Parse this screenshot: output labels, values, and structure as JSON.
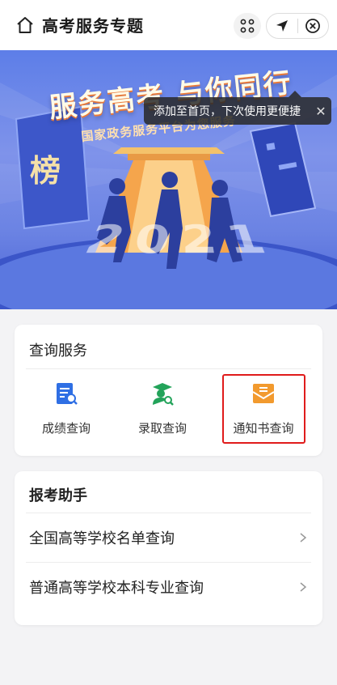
{
  "header": {
    "title": "高考服务专题",
    "home_icon": "home-icon",
    "more_icon": "more-dots-icon",
    "location_icon": "location-arrow-icon",
    "close_icon": "close-circle-icon"
  },
  "tooltip": {
    "text": "添加至首页，下次使用更便捷",
    "close_label": "✕"
  },
  "banner": {
    "slogan": "服务高考 与你同行",
    "sub_slogan": "国家政务服务平台为您服务",
    "board_char": "榜",
    "year": "2021"
  },
  "query_card": {
    "title": "查询服务",
    "items": [
      {
        "label": "成绩查询",
        "icon": "score-query-icon",
        "color": "#2f6fe4"
      },
      {
        "label": "录取查询",
        "icon": "admission-query-icon",
        "color": "#23a35a"
      },
      {
        "label": "通知书查询",
        "icon": "notice-letter-icon",
        "color": "#f29a2e"
      }
    ]
  },
  "assistant_card": {
    "title": "报考助手",
    "items": [
      {
        "label": "全国高等学校名单查询"
      },
      {
        "label": "普通高等学校本科专业查询"
      }
    ]
  },
  "colors": {
    "highlight": "#e01b1b",
    "banner_blue": "#5d7ee8"
  }
}
